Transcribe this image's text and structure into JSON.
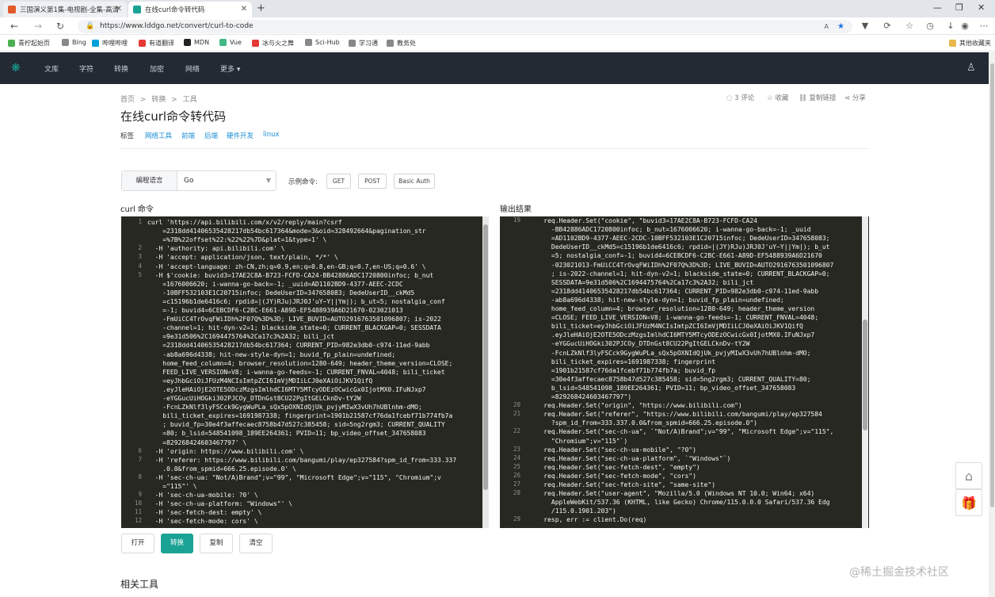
{
  "browser": {
    "tabs": [
      {
        "label": "三国演义第1集-电视剧-全集-高清",
        "color": "#e05a2a"
      },
      {
        "label": "在线curl命令转代码",
        "color": "#1aa394"
      }
    ],
    "new_tab": "+",
    "url": "https://www.lddgo.net/convert/curl-to-code",
    "bookmarks": [
      {
        "label": "青柠起始页",
        "color": "#4caf50"
      },
      {
        "label": "Bing",
        "color": "#888888"
      },
      {
        "label": "哔哩哔哩",
        "color": "#00a1d6"
      },
      {
        "label": "有道翻译",
        "color": "#e53935"
      },
      {
        "label": "MDN",
        "color": "#222222"
      },
      {
        "label": "Vue",
        "color": "#42b883"
      },
      {
        "label": "冰与火之舞",
        "color": "#e53935"
      },
      {
        "label": "Sci-Hub",
        "color": "#888888"
      },
      {
        "label": "学习通",
        "color": "#888888"
      },
      {
        "label": "教务处",
        "color": "#888888"
      }
    ],
    "other_favorites": "其他收藏夹"
  },
  "sitenav": {
    "items": [
      "文库",
      "字符",
      "转换",
      "加密",
      "网络",
      "更多 ▾"
    ]
  },
  "breadcrumb": [
    "首页",
    ">",
    "转换",
    ">",
    "工具"
  ],
  "title": "在线curl命令转代码",
  "tags_label": "标签",
  "tags": [
    "网络工具",
    "前端",
    "后端",
    "硬件开发",
    "linux"
  ],
  "actions": {
    "comments": "3 评论",
    "favorite": "收藏",
    "copy_link": "复制链接",
    "share": "分享"
  },
  "lang": {
    "label": "编程语言",
    "value": "Go"
  },
  "examples": {
    "label": "示例命令:",
    "buttons": [
      "GET",
      "POST",
      "Basic Auth"
    ]
  },
  "curl_label": "curl 命令",
  "output_label": "输出结果",
  "curl_editor": {
    "lines": [
      {
        "n": "1",
        "text": "curl 'https://api.bilibili.com/x/v2/reply/main?csrf"
      },
      {
        "n": "",
        "text": "    =2318dd41406535428217db54bc617364&mode=3&oid=328492664&pagination_str"
      },
      {
        "n": "",
        "text": "    =%7B%22offset%22:%22%22%7D&plat=1&type=1' \\"
      },
      {
        "n": "2",
        "text": "  -H 'authority: api.bilibili.com' \\"
      },
      {
        "n": "3",
        "text": "  -H 'accept: application/json, text/plain, */*' \\"
      },
      {
        "n": "4",
        "text": "  -H 'accept-language: zh-CN,zh;q=0.9,en;q=0.8,en-GB;q=0.7,en-US;q=0.6' \\"
      },
      {
        "n": "5",
        "text": "  -H $'cookie: buvid3=17AE2C8A-B723-FCFD-CA24-BB42886ADC1720800infoc; b_nut"
      },
      {
        "n": "",
        "text": "    =1676006620; i-wanna-go-back=-1; _uuid=AD1102BD9-4377-AEEC-2CDC"
      },
      {
        "n": "",
        "text": "    -10BFF532103E1C20715infoc; DedeUserID=347658083; DedeUserID__ckMd5"
      },
      {
        "n": "",
        "text": "    =c15196b1de6416c6; rpdid=|(JY)RJu)JRJ0J'uY~Y||Ym|); b_ut=5; nostalgia_conf"
      },
      {
        "n": "",
        "text": "    =-1; buvid4=6CEBCDF6-C2BC-E661-A89D-EF5488939A6D21670-023021013"
      },
      {
        "n": "",
        "text": "    -FmUiCC4TrOvqFWiIDh%2F07Q%3D%3D; LIVE_BUVID=AUTO2916763501096807; is-2022"
      },
      {
        "n": "",
        "text": "    -channel=1; hit-dyn-v2=1; blackside_state=0; CURRENT_BLACKGAP=0; SESSDATA"
      },
      {
        "n": "",
        "text": "    =9e31d506%2C1694475764%2Ca17c3%2A32; bili_jct"
      },
      {
        "n": "",
        "text": "    =2318dd41406535428217db54bc617364; CURRENT_PID=982e3db0-c974-11ed-9abb"
      },
      {
        "n": "",
        "text": "    -ab8a696d4338; hit-new-style-dyn=1; buvid_fp_plain=undefined;"
      },
      {
        "n": "",
        "text": "    home_feed_column=4; browser_resolution=1280-649; header_theme_version=CLOSE;"
      },
      {
        "n": "",
        "text": "    FEED_LIVE_VERSION=V8; i-wanna-go-feeds=-1; CURRENT_FNVAL=4048; bili_ticket"
      },
      {
        "n": "",
        "text": "    =eyJhbGciOiJFUzM4NCIsImtpZCI6ImVjMDIiLCJ0eXAiOiJKV1QifQ"
      },
      {
        "n": "",
        "text": "    .eyJleHAiOjE2OTE5ODczMzgsImlhdCI6MTY5MTcyODEzOCwicGx0IjotMX0.IFuNJxp7"
      },
      {
        "n": "",
        "text": "    -eYGGucUiHOGki302PJCOy_DTDnGst8CU22PgItGELCknDv-tY2W"
      },
      {
        "n": "",
        "text": "    -FcnLZkNlf3lyFSCck9GygWuPLa_sQx5pOXNIdQjUk_pvjyMIwX3vUh7hUBlnhm-dMO;"
      },
      {
        "n": "",
        "text": "    bili_ticket_expires=1691987338; fingerprint=1901b21587cf76da1fcebf71b774fb7a"
      },
      {
        "n": "",
        "text": "    ; buvid_fp=30e4f3affecaec8758b47d527c385458; sid=5ng2rgm3; CURRENT_QUALITY"
      },
      {
        "n": "",
        "text": "    =80; b_lsid=548541098_189EE264361; PVID=11; bp_video_offset_347658083"
      },
      {
        "n": "",
        "text": "    =829268424603467797' \\"
      },
      {
        "n": "6",
        "text": "  -H 'origin: https://www.bilibili.com' \\"
      },
      {
        "n": "7",
        "text": "  -H 'referer: https://www.bilibili.com/bangumi/play/ep327584?spm_id_from=333.337"
      },
      {
        "n": "",
        "text": "    .0.0&from_spmid=666.25.episode.0' \\"
      },
      {
        "n": "8",
        "text": "  -H 'sec-ch-ua: \"Not/A)Brand\";v=\"99\", \"Microsoft Edge\";v=\"115\", \"Chromium\";v"
      },
      {
        "n": "",
        "text": "    =\"115\"' \\"
      },
      {
        "n": "9",
        "text": "  -H 'sec-ch-ua-mobile: ?0' \\"
      },
      {
        "n": "10",
        "text": "  -H 'sec-ch-ua-platform: \"Windows\"' \\"
      },
      {
        "n": "11",
        "text": "  -H 'sec-fetch-dest: empty' \\"
      },
      {
        "n": "12",
        "text": "  -H 'sec-fetch-mode: cors' \\"
      }
    ]
  },
  "output_editor": {
    "lines": [
      {
        "n": "19",
        "text": "    req.Header.Set(\"cookie\", \"buvid3=17AE2C8A-B723-FCFD-CA24"
      },
      {
        "n": "",
        "text": "      -BB42886ADC1720800infoc; b_nut=1676006620; i-wanna-go-back=-1; _uuid"
      },
      {
        "n": "",
        "text": "      =AD1102BD9-4377-AEEC-2CDC-10BFF532103E1C20715infoc; DedeUserID=347658083;"
      },
      {
        "n": "",
        "text": "      DedeUserID__ckMd5=c15196b1de6416c6; rpdid=|(JY)RJu)JRJ0J'uY~Y||Ym|); b_ut"
      },
      {
        "n": "",
        "text": "      =5; nostalgia_conf=-1; buvid4=6CEBCDF6-C2BC-E661-A89D-EF5488939A6D21670"
      },
      {
        "n": "",
        "text": "      -023021013-FmUiCC4TrOvqFWiIDh%2F07Q%3D%3D; LIVE_BUVID=AUTO2916763501096807"
      },
      {
        "n": "",
        "text": "      ; is-2022-channel=1; hit-dyn-v2=1; blackside_state=0; CURRENT_BLACKGAP=0;"
      },
      {
        "n": "",
        "text": "      SESSDATA=9e31d506%2C1694475764%2Ca17c3%2A32; bili_jct"
      },
      {
        "n": "",
        "text": "      =2318dd41406535428217db54bc617364; CURRENT_PID=982e3db0-c974-11ed-9abb"
      },
      {
        "n": "",
        "text": "      -ab8a696d4338; hit-new-style-dyn=1; buvid_fp_plain=undefined;"
      },
      {
        "n": "",
        "text": "      home_feed_column=4; browser_resolution=1280-649; header_theme_version"
      },
      {
        "n": "",
        "text": "      =CLOSE; FEED_LIVE_VERSION=V8; i-wanna-go-feeds=-1; CURRENT_FNVAL=4048;"
      },
      {
        "n": "",
        "text": "      bili_ticket=eyJhbGciOiJFUzM4NCIsImtpZCI6ImVjMDIiLCJ0eXAiOiJKV1QifQ"
      },
      {
        "n": "",
        "text": "      .eyJleHAiOjE2OTE5ODczMzgsImlhdCI6MTY5MTcyODEzOCwicGx0IjotMX0.IFuNJxp7"
      },
      {
        "n": "",
        "text": "      -eYGGucUiHOGki302PJCOy_DTDnGst8CU22PgItGELCknDv-tY2W"
      },
      {
        "n": "",
        "text": "      -FcnLZkNlf3lyFSCck9GygWuPLa_sQx5pOXNIdQjUk_pvjyMIwX3vUh7hUBlnhm-dMO;"
      },
      {
        "n": "",
        "text": "      bili_ticket_expires=1691987338; fingerprint"
      },
      {
        "n": "",
        "text": "      =1901b21587cf76da1fcebf71b774fb7a; buvid_fp"
      },
      {
        "n": "",
        "text": "      =30e4f3affecaec8758b47d527c385458; sid=5ng2rgm3; CURRENT_QUALITY=80;"
      },
      {
        "n": "",
        "text": "      b_lsid=548541098_189EE264361; PVID=11; bp_video_offset_347658083"
      },
      {
        "n": "",
        "text": "      =829268424603467797\")"
      },
      {
        "n": "20",
        "text": "    req.Header.Set(\"origin\", \"https://www.bilibili.com\")"
      },
      {
        "n": "21",
        "text": "    req.Header.Set(\"referer\", \"https://www.bilibili.com/bangumi/play/ep327584"
      },
      {
        "n": "",
        "text": "      ?spm_id_from=333.337.0.0&from_spmid=666.25.episode.0\")"
      },
      {
        "n": "22",
        "text": "    req.Header.Set(\"sec-ch-ua\", `\"Not/A)Brand\";v=\"99\", \"Microsoft Edge\";v=\"115\","
      },
      {
        "n": "",
        "text": "      \"Chromium\";v=\"115\"`)"
      },
      {
        "n": "23",
        "text": "    req.Header.Set(\"sec-ch-ua-mobile\", \"?0\")"
      },
      {
        "n": "24",
        "text": "    req.Header.Set(\"sec-ch-ua-platform\", `\"Windows\"`)"
      },
      {
        "n": "25",
        "text": "    req.Header.Set(\"sec-fetch-dest\", \"empty\")"
      },
      {
        "n": "26",
        "text": "    req.Header.Set(\"sec-fetch-mode\", \"cors\")"
      },
      {
        "n": "27",
        "text": "    req.Header.Set(\"sec-fetch-site\", \"same-site\")"
      },
      {
        "n": "28",
        "text": "    req.Header.Set(\"user-agent\", \"Mozilla/5.0 (Windows NT 10.0; Win64; x64)"
      },
      {
        "n": "",
        "text": "      AppleWebKit/537.36 (KHTML, like Gecko) Chrome/115.0.0.0 Safari/537.36 Edg"
      },
      {
        "n": "",
        "text": "      /115.0.1901.203\")"
      },
      {
        "n": "29",
        "text": "    resp, err := client.Do(req)"
      }
    ]
  },
  "buttons": [
    "打开",
    "转换",
    "复制",
    "清空"
  ],
  "related": "相关工具",
  "watermark": "@稀土掘金技术社区",
  "colors": {
    "accent": "#1aa394",
    "editor_bg": "#272822",
    "nav_bg": "#232a34"
  }
}
